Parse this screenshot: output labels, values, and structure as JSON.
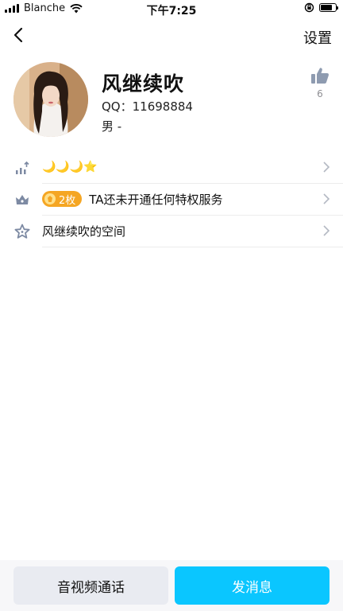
{
  "status_bar": {
    "carrier": "Blanche",
    "time": "下午7:25",
    "battery_level": 0.8
  },
  "nav": {
    "back_icon": "chevron-left-icon",
    "settings_label": "设置"
  },
  "profile": {
    "name": "风继续吹",
    "qq": "QQ：11698884",
    "gender": "男 -",
    "like_count": "6"
  },
  "rows": [
    {
      "icon": "level-up-icon",
      "value": "🌙🌙🌙⭐"
    },
    {
      "icon": "crown-icon",
      "badge": "2枚",
      "text": "TA还未开通任何特权服务"
    },
    {
      "icon": "star-icon",
      "text": "风继续吹的空间"
    }
  ],
  "actions": {
    "call_label": "音视频通话",
    "message_label": "发消息"
  },
  "colors": {
    "accent": "#0ac6ff",
    "badge": "#f5a623",
    "icon_gray": "#7d8aa3"
  }
}
